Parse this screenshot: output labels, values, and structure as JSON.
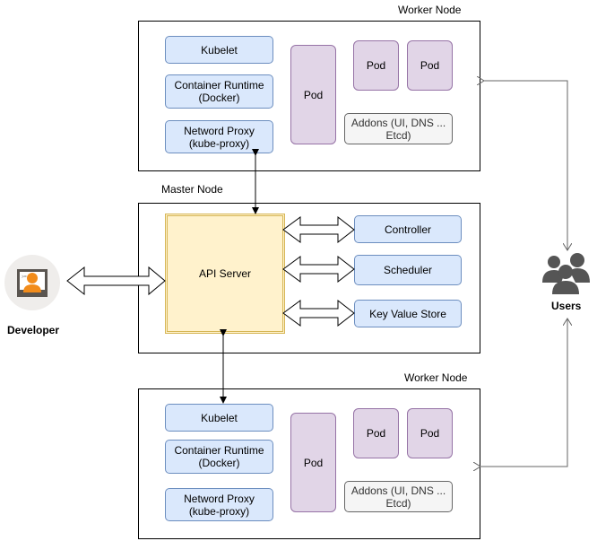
{
  "worker_top": {
    "title": "Worker Node",
    "kubelet": "Kubelet",
    "runtime": "Container Runtime\n(Docker)",
    "proxy": "Netword Proxy\n(kube-proxy)",
    "pod_large": "Pod",
    "pod_a": "Pod",
    "pod_b": "Pod",
    "addons": "Addons (UI, DNS ...\nEtcd)"
  },
  "master": {
    "title": "Master Node",
    "api_server": "API Server",
    "controller": "Controller",
    "scheduler": "Scheduler",
    "kv_store": "Key Value Store"
  },
  "worker_bottom": {
    "title": "Worker Node",
    "kubelet": "Kubelet",
    "runtime": "Container Runtime\n(Docker)",
    "proxy": "Netword Proxy\n(kube-proxy)",
    "pod_large": "Pod",
    "pod_a": "Pod",
    "pod_b": "Pod",
    "addons": "Addons (UI, DNS ...\nEtcd)"
  },
  "actors": {
    "developer": "Developer",
    "users": "Users"
  },
  "colors": {
    "component_fill": "#dae8fc",
    "component_stroke": "#6c8ebf",
    "pod_fill": "#e1d5e7",
    "pod_stroke": "#9673a6",
    "api_fill": "#fff2cc",
    "api_stroke": "#d6b656",
    "addons_fill": "#f5f5f5"
  }
}
